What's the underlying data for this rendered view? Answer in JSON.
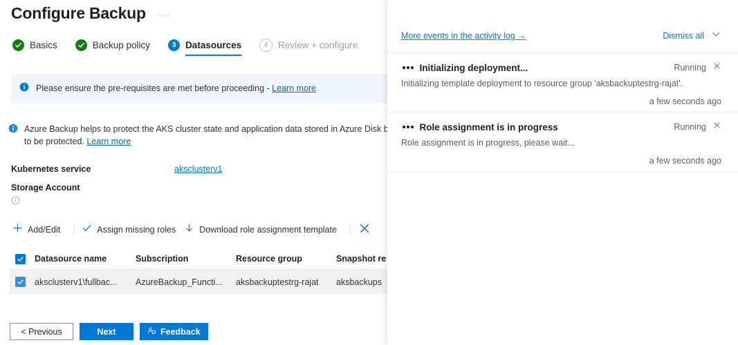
{
  "blade": {
    "title": "Configure Backup",
    "ellipsis": "···",
    "steps": [
      {
        "label": "Basics",
        "state": "done",
        "marker": "check"
      },
      {
        "label": "Backup policy",
        "state": "done",
        "marker": "check"
      },
      {
        "label": "Datasources",
        "state": "current",
        "marker": "3"
      },
      {
        "label": "Review + configure",
        "state": "todo",
        "marker": "4"
      }
    ],
    "banner": {
      "text": "Please ensure the pre-requisites are met before proceeding - ",
      "link": "Learn more"
    },
    "note": {
      "line1": "Azure Backup helps to protect the AKS cluster state and application data stored in Azure Disk based P",
      "line2": "to be protected. ",
      "link": "Learn more"
    },
    "fields": [
      {
        "label": "Kubernetes service",
        "value": "aksclusterv1",
        "type": "link"
      },
      {
        "label": "Storage Account",
        "value": "",
        "type": "info"
      }
    ],
    "commands": [
      {
        "label": "Add/Edit",
        "icon": "plus-icon"
      },
      {
        "label": "Assign missing roles",
        "icon": "check-icon"
      },
      {
        "label": "Download role assignment template",
        "icon": "download-icon"
      },
      {
        "label": "",
        "icon": "close-icon"
      }
    ],
    "table": {
      "columns": [
        "Datasource name",
        "Subscription",
        "Resource group",
        "Snapshot re"
      ],
      "rows": [
        {
          "selected": true,
          "cells": [
            "aksclusterv1\\fullbac...",
            "AzureBackup_Functi...",
            "aksbackuptestrg-rajat",
            "aksbackups"
          ]
        }
      ]
    },
    "footer": {
      "previous": "< Previous",
      "next": "Next",
      "feedback": "Feedback"
    }
  },
  "flyout": {
    "more_events": "More events in the activity log →",
    "dismiss_all": "Dismiss all",
    "notifications": [
      {
        "title": "Initializing deployment...",
        "status": "Running",
        "description": "Initializing template deployment to resource group 'aksbackuptestrg-rajat'.",
        "time": "a few seconds ago"
      },
      {
        "title": "Role assignment is in progress",
        "status": "Running",
        "description": "Role assignment is in progress, please wait...",
        "time": "a few seconds ago"
      }
    ]
  },
  "colors": {
    "accent": "#0078d4",
    "success": "#107c10",
    "link": "#0067b8",
    "banner_bg": "#eff6fc"
  }
}
